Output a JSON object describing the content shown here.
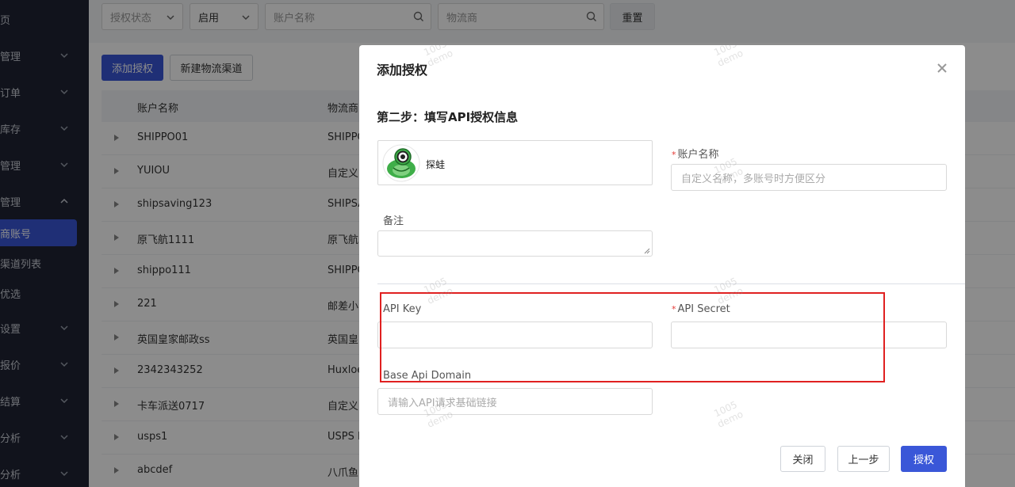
{
  "sidebar": {
    "items": [
      {
        "label": "管理"
      },
      {
        "label": "订单"
      },
      {
        "label": "库存"
      },
      {
        "label": "管理"
      },
      {
        "label": "管理"
      },
      {
        "label": "设置"
      },
      {
        "label": "报价"
      },
      {
        "label": "结算"
      },
      {
        "label": "分析"
      }
    ],
    "top_label": "页",
    "subitems": [
      {
        "label": "商账号"
      },
      {
        "label": "渠道列表"
      },
      {
        "label": "优选"
      }
    ]
  },
  "filters": {
    "auth_status_placeholder": "授权状态",
    "enable_value": "启用",
    "account_name_placeholder": "账户名称",
    "carrier_placeholder": "物流商",
    "reset_label": "重置"
  },
  "toolbar": {
    "add_auth_label": "添加授权",
    "new_channel_label": "新建物流渠道"
  },
  "table": {
    "columns": [
      "账户名称",
      "物流商"
    ],
    "rows": [
      {
        "name": "SHIPPO01",
        "carrier": "SHIPPO"
      },
      {
        "name": "YUIOU",
        "carrier": "自定义"
      },
      {
        "name": "shipsaving123",
        "carrier": "SHIPSA"
      },
      {
        "name": "原飞航1111",
        "carrier": "原飞航"
      },
      {
        "name": "shippo111",
        "carrier": "SHIPPO"
      },
      {
        "name": "221",
        "carrier": "邮差小"
      },
      {
        "name": "英国皇家邮政ss",
        "carrier": "英国皇"
      },
      {
        "name": "2342343252",
        "carrier": "Huxloe"
      },
      {
        "name": "卡车派送0717",
        "carrier": "自定义"
      },
      {
        "name": "usps1",
        "carrier": "USPS D"
      },
      {
        "name": "abcdef",
        "carrier": "八爪鱼"
      }
    ]
  },
  "modal": {
    "title": "添加授权",
    "step_title": "第二步：填写API授权信息",
    "carrier_name": "探蛙",
    "fields": {
      "account_name_label": "账户名称",
      "account_name_placeholder": "自定义名称，多账号时方便区分",
      "remark_label": "备注",
      "api_key_label": "API Key",
      "api_secret_label": "API Secret",
      "base_domain_label": "Base Api Domain",
      "base_domain_placeholder": "请输入API请求基础链接",
      "required_mark": "*"
    },
    "buttons": {
      "close_label": "关闭",
      "prev_label": "上一步",
      "authorize_label": "授权"
    }
  },
  "watermark": {
    "line1": "1005",
    "line2": "demo"
  },
  "colors": {
    "primary": "#3a57d8",
    "sidebar_bg": "#1f2433",
    "highlight": "#e02020",
    "required": "#e53935"
  }
}
